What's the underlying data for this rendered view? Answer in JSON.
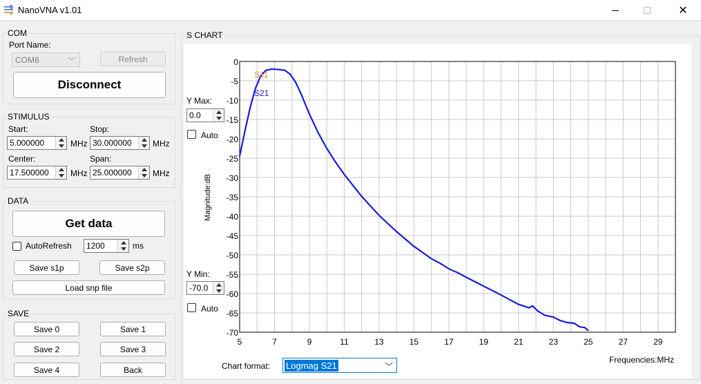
{
  "window": {
    "title": "NanoVNA v1.01",
    "icon": "nanovna-app-icon",
    "close_symbol": "✕"
  },
  "com": {
    "group_label": "COM",
    "port_label": "Port Name:",
    "port_value": "COM8",
    "refresh_label": "Refresh",
    "disconnect_label": "Disconnect"
  },
  "stimulus": {
    "group_label": "STIMULUS",
    "start_label": "Start:",
    "start_value": "5.000000",
    "stop_label": "Stop:",
    "stop_value": "30.000000",
    "center_label": "Center:",
    "center_value": "17.500000",
    "span_label": "Span:",
    "span_value": "25.000000",
    "unit": "MHz"
  },
  "data": {
    "group_label": "DATA",
    "get_data_label": "Get data",
    "autorefresh_label": "AutoRefresh",
    "autorefresh_checked": false,
    "interval_value": "1200",
    "interval_unit": "ms",
    "save_s1p_label": "Save s1p",
    "save_s2p_label": "Save s2p",
    "load_snp_label": "Load snp file"
  },
  "save": {
    "group_label": "SAVE",
    "buttons": [
      "Save 0",
      "Save 1",
      "Save 2",
      "Save 3",
      "Save 4",
      "Back"
    ]
  },
  "chart_panel": {
    "group_label": "S CHART",
    "ymax_label": "Y Max:",
    "ymax_value": "0.0",
    "ymin_label": "Y Min:",
    "ymin_value": "-70.0",
    "auto_label": "Auto",
    "chart_format_label": "Chart format:",
    "chart_format_value": "Logmag S21"
  },
  "chart_data": {
    "type": "line",
    "xlabel": "Frequencies:MHz",
    "ylabel": "Magnitude:dB",
    "xlim": [
      5,
      30
    ],
    "ylim": [
      -70,
      0
    ],
    "x_ticks": [
      "5",
      "7",
      "9",
      "11",
      "13",
      "15",
      "17",
      "19",
      "21",
      "23",
      "25",
      "27",
      "29"
    ],
    "y_ticks": [
      "0",
      "-5",
      "-10",
      "-15",
      "-20",
      "-25",
      "-30",
      "-35",
      "-40",
      "-45",
      "-50",
      "-55",
      "-60",
      "-65",
      "-70"
    ],
    "grid": true,
    "legend": [
      "S11",
      "S21"
    ],
    "colors": {
      "S11": "#f08a24",
      "S21": "#1a1adb",
      "line": "#1a1adb"
    },
    "series": [
      {
        "name": "S21",
        "x": [
          5,
          5.3,
          5.6,
          5.9,
          6.2,
          6.5,
          6.8,
          7.0,
          7.3,
          7.6,
          7.9,
          8.2,
          8.5,
          9.0,
          9.5,
          10.0,
          10.5,
          11.0,
          12.0,
          13.0,
          14.0,
          15.0,
          16.0,
          16.5,
          17.0,
          17.5,
          18.0,
          19.0,
          20.0,
          21.0,
          21.6,
          21.8,
          22.1,
          22.5,
          23.0,
          23.4,
          23.8,
          24.2,
          24.5,
          24.8,
          25.0
        ],
        "y": [
          -24.5,
          -18.0,
          -12.0,
          -7.0,
          -3.8,
          -2.3,
          -2.0,
          -2.0,
          -2.1,
          -2.3,
          -3.3,
          -5.3,
          -8.1,
          -13.6,
          -18.4,
          -22.5,
          -26.0,
          -29.2,
          -34.9,
          -39.8,
          -44.0,
          -47.8,
          -51.0,
          -52.2,
          -53.6,
          -54.6,
          -55.8,
          -58.1,
          -60.4,
          -62.8,
          -63.7,
          -63.2,
          -64.5,
          -65.6,
          -66.1,
          -67.0,
          -67.5,
          -67.7,
          -68.6,
          -68.8,
          -69.6
        ]
      }
    ]
  }
}
